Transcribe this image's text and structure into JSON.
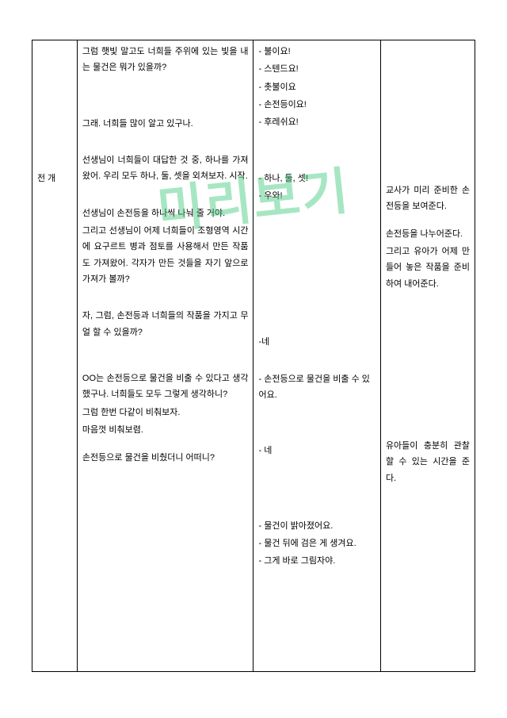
{
  "watermark": "미리보기",
  "col_a": {
    "label": "전 개"
  },
  "col_b": {
    "b1": " 그럼 햇빛 말고도 너희들 주위에 있는 빛을 내는 물건은 뭐가 있을까?",
    "b2": "그래. 너희들 많이 알고 있구나.",
    "b3": "선생님이 너희들이 대답한 것 중, 하나를 가져왔어. 우리 모두 하나, 둘, 셋을 외쳐보자. 시작.",
    "b4": "선생님이 손전등을 하나씩 나눠 줄 거야.",
    "b5": "그리고 선생님이 어제 너희들이 조형영역 시간에 요구르트 병과 점토를 사용해서 만든 작품도 가져왔어. 각자가 만든 것들을 자기 앞으로 가져가 볼까?",
    "b6": "자, 그럼, 손전등과 너희들의 작품을 가지고 무얼 할 수 있을까?",
    "b7": "OO는 손전등으로 물건을 비출 수 있다고 생각했구나. 너희들도 모두 그렇게 생각하니?",
    "b8": "그럼 한번 다같이 비춰보자.",
    "b9": "마음껏 비춰보렴.",
    "b10": "손전등으로 물건을 비췄더니 어떠니?"
  },
  "col_c": {
    "c1a": "- 불이요!",
    "c1b": "- 스텐드요!",
    "c1c": "- 촛불이요",
    "c1d": "- 손전등이요!",
    "c1e": "- 후레쉬요!",
    "c2a": "- 하나, 둘, 셋!",
    "c2b": "- 우와!",
    "c3": "-네",
    "c4": "- 손전등으로 물건을 비출 수 있어요.",
    "c5": "- 네",
    "c6a": "- 물건이 밝아졌어요.",
    "c6b": "- 물건 뒤에 검은 게 생겨요.",
    "c6c": "- 그게 바로 그림자야."
  },
  "col_d": {
    "d1": "교사가 미리 준비한 손전등을 보여준다.",
    "d2": "손전등을 나누어준다.",
    "d3": "그리고 유아가 어제 만들어 놓은 작품을 준비하여 내어준다.",
    "d4": "유아들이 충분히 관찰할 수 있는 시간을 준다."
  }
}
